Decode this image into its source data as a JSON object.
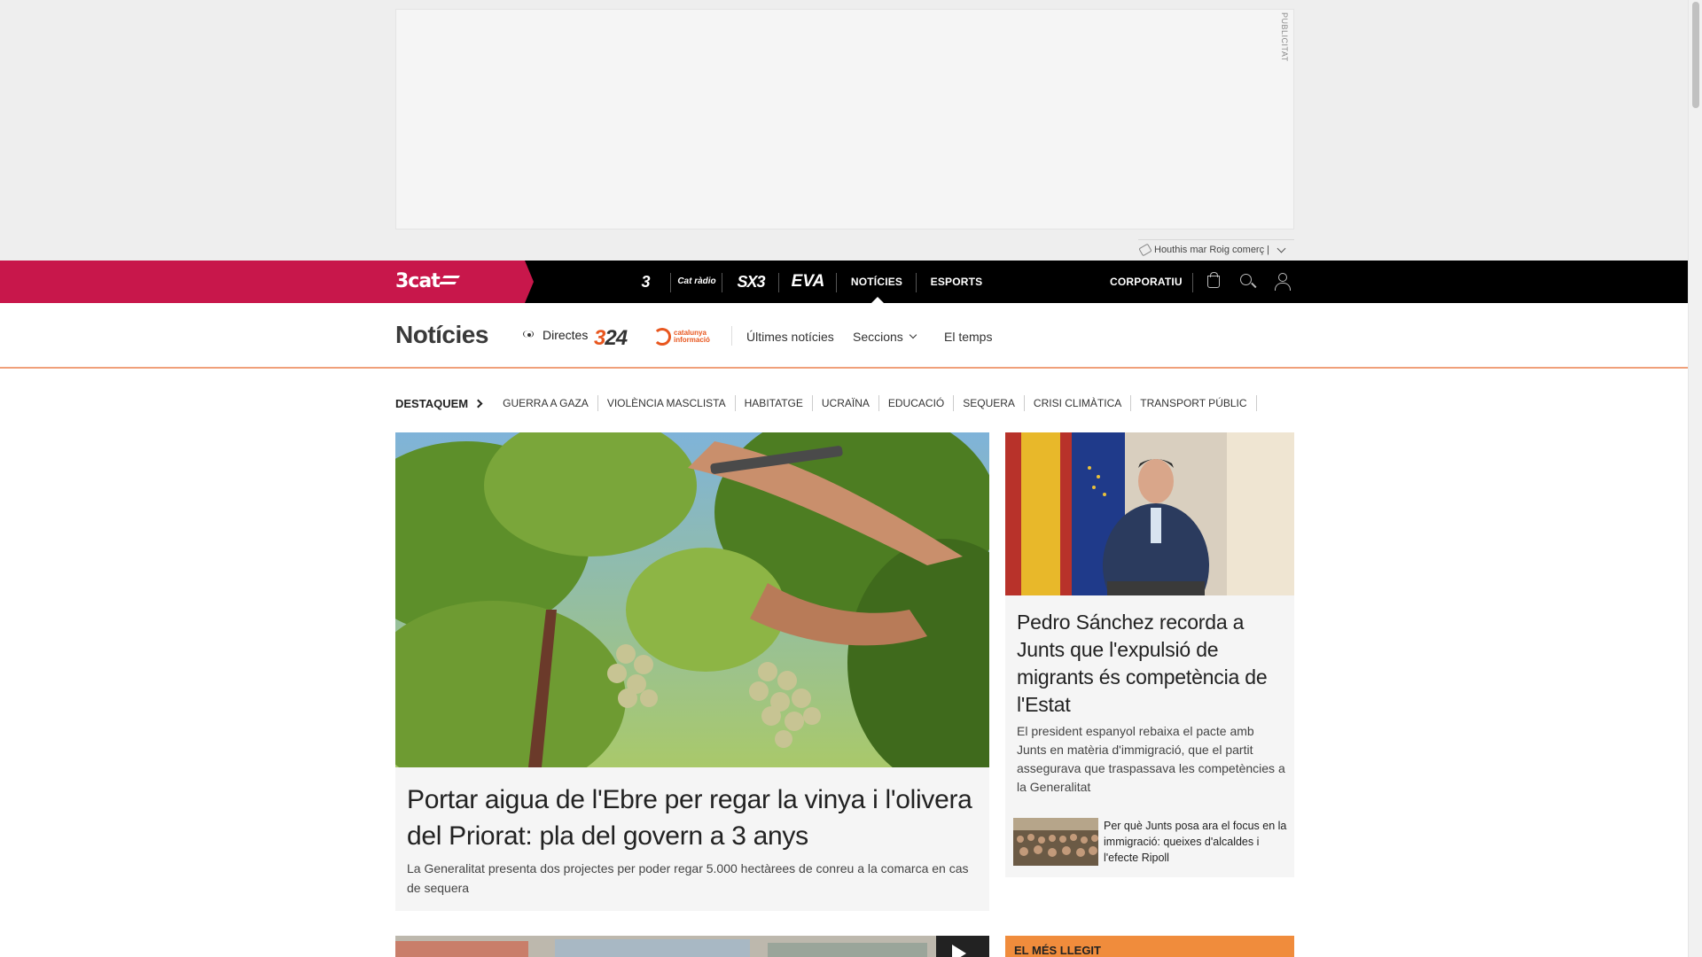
{
  "ad": {
    "label": "PUBLICITAT",
    "tags_text": "Houthis mar Roig comerç |"
  },
  "topnav": {
    "brand": "3cat",
    "channels": {
      "tv3": "3",
      "radio": "Cat ràdio",
      "sx3": "SX3",
      "eva": "EVA"
    },
    "noticies": "NOTÍCIES",
    "esports": "ESPORTS",
    "corporatiu": "CORPORATIU"
  },
  "section": {
    "title": "Notícies",
    "directes": "Directes",
    "logo_324": "3",
    "logo_324_rest": "24",
    "logo_ci": "catalunya informació",
    "ultimes": "Últimes notícies",
    "seccions": "Seccions",
    "temps": "El temps"
  },
  "highlights": {
    "title": "DESTAQUEM",
    "items": [
      "GUERRA A GAZA",
      "VIOLÈNCIA MASCLISTA",
      "HABITATGE",
      "UCRAÏNA",
      "EDUCACIÓ",
      "SEQUERA",
      "CRISI CLIMÀTICA",
      "TRANSPORT PÚBLIC"
    ]
  },
  "main_story": {
    "title": "Portar aigua de l'Ebre per regar la vinya i l'olivera del Priorat: pla del govern a 3 anys",
    "summary": "La Generalitat presenta dos projectes per poder regar 5.000 hectàrees de conreu a la comarca en cas de sequera"
  },
  "side_story": {
    "title": "Pedro Sánchez recorda a Junts que l'expulsió de migrants és competència de l'Estat",
    "summary": "El president espanyol rebaixa el pacte amb Junts en matèria d'immigració, que el partit assegurava que traspassava les competències a la Generalitat",
    "related": "Per què Junts posa ara el focus en la immigració: queixes d'alcaldes i l'efecte Ripoll"
  },
  "most_read": {
    "title": "EL MÉS LLEGIT"
  },
  "colors": {
    "brand_red": "#c8174b",
    "accent_orange": "#e8561e",
    "most_read": "#f08c3c"
  }
}
